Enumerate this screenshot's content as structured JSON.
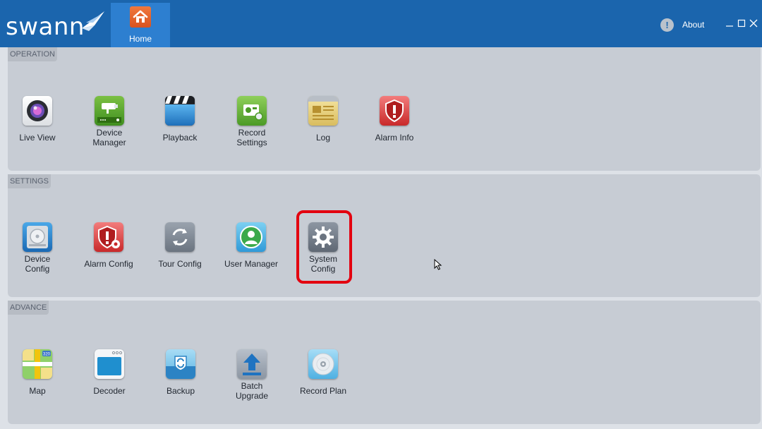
{
  "brand": {
    "name": "swann"
  },
  "nav": {
    "home_label": "Home",
    "about_label": "About"
  },
  "sections": {
    "operation": {
      "title": "OPERATION",
      "items": [
        {
          "label1": "Live View"
        },
        {
          "label1": "Device",
          "label2": "Manager"
        },
        {
          "label1": "Playback"
        },
        {
          "label1": "Record",
          "label2": "Settings"
        },
        {
          "label1": "Log"
        },
        {
          "label1": "Alarm Info"
        }
      ]
    },
    "settings": {
      "title": "SETTINGS",
      "items": [
        {
          "label1": "Device",
          "label2": "Config"
        },
        {
          "label1": "Alarm Config"
        },
        {
          "label1": "Tour Config"
        },
        {
          "label1": "User Manager"
        },
        {
          "label1": "System",
          "label2": "Config"
        }
      ]
    },
    "advance": {
      "title": "ADVANCE",
      "items": [
        {
          "label1": "Map"
        },
        {
          "label1": "Decoder"
        },
        {
          "label1": "Backup"
        },
        {
          "label1": "Batch",
          "label2": "Upgrade"
        },
        {
          "label1": "Record Plan"
        }
      ]
    }
  },
  "map_icon_badge": "320",
  "colors": {
    "topbar": "#1b65ad",
    "home_tab": "#2d7fd0",
    "panel": "#c7ccd4",
    "highlight": "#e3000f"
  },
  "icons": {
    "home": "house-icon",
    "about": "info-icon",
    "live_view": "camera-lens-icon",
    "device_manager": "cctv-camera-icon",
    "playback": "clapperboard-icon",
    "record_settings": "recorder-gear-icon",
    "log": "log-sheet-icon",
    "alarm_info": "alarm-shield-icon",
    "device_config": "hard-drive-icon",
    "alarm_config": "alarm-shield-gear-icon",
    "tour_config": "refresh-cycle-icon",
    "user_manager": "user-icon",
    "system_config": "gear-icon",
    "map": "map-icon",
    "decoder": "decoder-window-icon",
    "backup": "backup-icon",
    "batch_upgrade": "upload-arrow-icon",
    "record_plan": "disc-icon"
  }
}
